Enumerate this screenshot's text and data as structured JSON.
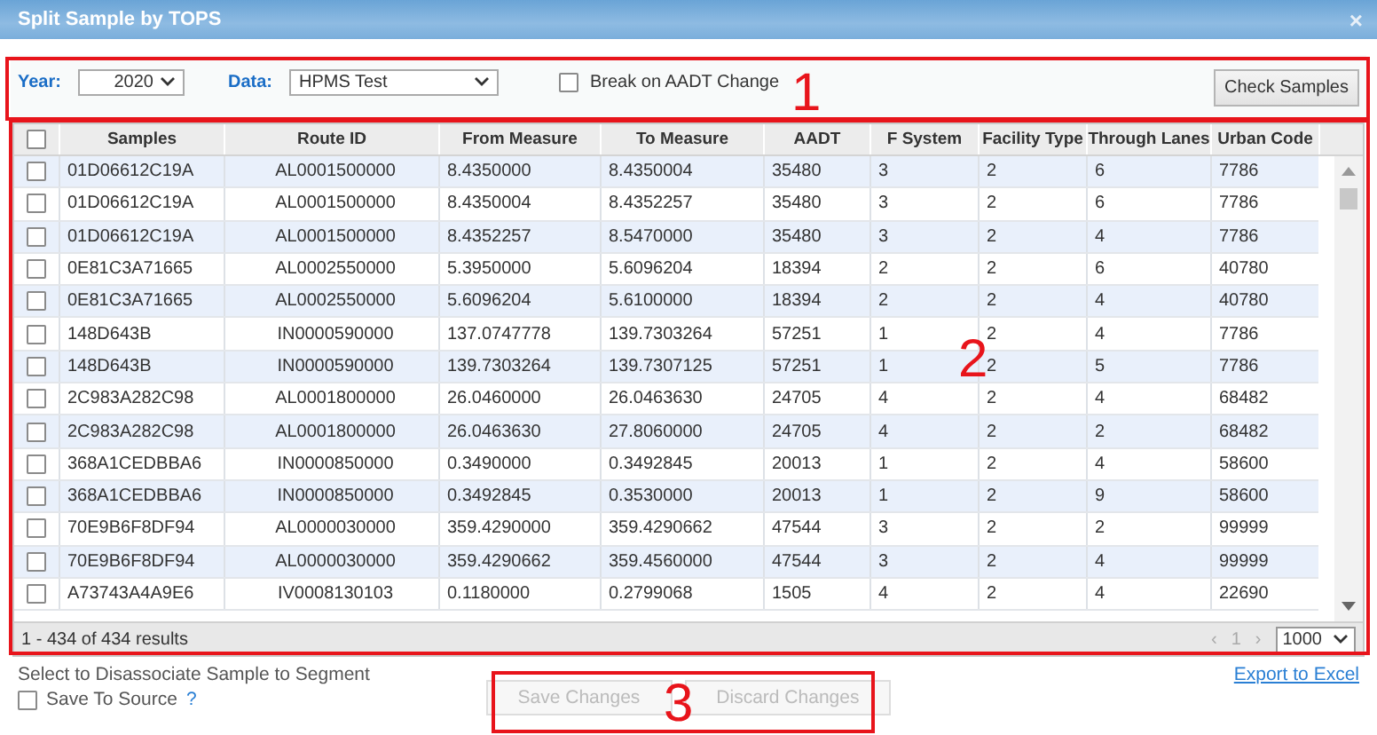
{
  "window": {
    "title": "Split Sample by TOPS",
    "close": "×"
  },
  "toolbar": {
    "year_label": "Year:",
    "year": "2020",
    "data_label": "Data:",
    "data": "HPMS Test",
    "break_on_aadt": {
      "label": "Break on AADT Change",
      "checked": false
    },
    "check_button": "Check Samples"
  },
  "table": {
    "select_all_checked": false,
    "columns": [
      "Samples",
      "Route ID",
      "From Measure",
      "To Measure",
      "AADT",
      "F System",
      "Facility Type",
      "Through Lanes",
      "Urban Code"
    ],
    "rows": [
      {
        "checked": false,
        "cells": [
          "01D06612C19A",
          "AL0001500000",
          "8.4350000",
          "8.4350004",
          "35480",
          "3",
          "2",
          "6",
          "7786"
        ]
      },
      {
        "checked": false,
        "cells": [
          "01D06612C19A",
          "AL0001500000",
          "8.4350004",
          "8.4352257",
          "35480",
          "3",
          "2",
          "6",
          "7786"
        ]
      },
      {
        "checked": false,
        "cells": [
          "01D06612C19A",
          "AL0001500000",
          "8.4352257",
          "8.5470000",
          "35480",
          "3",
          "2",
          "4",
          "7786"
        ]
      },
      {
        "checked": false,
        "cells": [
          "0E81C3A71665",
          "AL0002550000",
          "5.3950000",
          "5.6096204",
          "18394",
          "2",
          "2",
          "6",
          "40780"
        ]
      },
      {
        "checked": false,
        "cells": [
          "0E81C3A71665",
          "AL0002550000",
          "5.6096204",
          "5.6100000",
          "18394",
          "2",
          "2",
          "4",
          "40780"
        ]
      },
      {
        "checked": false,
        "cells": [
          "148D643B",
          "IN0000590000",
          "137.0747778",
          "139.7303264",
          "57251",
          "1",
          "2",
          "4",
          "7786"
        ]
      },
      {
        "checked": false,
        "cells": [
          "148D643B",
          "IN0000590000",
          "139.7303264",
          "139.7307125",
          "57251",
          "1",
          "2",
          "5",
          "7786"
        ]
      },
      {
        "checked": false,
        "cells": [
          "2C983A282C98",
          "AL0001800000",
          "26.0460000",
          "26.0463630",
          "24705",
          "4",
          "2",
          "4",
          "68482"
        ]
      },
      {
        "checked": false,
        "cells": [
          "2C983A282C98",
          "AL0001800000",
          "26.0463630",
          "27.8060000",
          "24705",
          "4",
          "2",
          "2",
          "68482"
        ]
      },
      {
        "checked": false,
        "cells": [
          "368A1CEDBBA6",
          "IN0000850000",
          "0.3490000",
          "0.3492845",
          "20013",
          "1",
          "2",
          "4",
          "58600"
        ]
      },
      {
        "checked": false,
        "cells": [
          "368A1CEDBBA6",
          "IN0000850000",
          "0.3492845",
          "0.3530000",
          "20013",
          "1",
          "2",
          "9",
          "58600"
        ]
      },
      {
        "checked": false,
        "cells": [
          "70E9B6F8DF94",
          "AL0000030000",
          "359.4290000",
          "359.4290662",
          "47544",
          "3",
          "2",
          "2",
          "99999"
        ]
      },
      {
        "checked": false,
        "cells": [
          "70E9B6F8DF94",
          "AL0000030000",
          "359.4290662",
          "359.4560000",
          "47544",
          "3",
          "2",
          "4",
          "99999"
        ]
      },
      {
        "checked": false,
        "cells": [
          "A73743A4A9E6",
          "IV0008130103",
          "0.1180000",
          "0.2799068",
          "1505",
          "4",
          "2",
          "4",
          "22690"
        ]
      }
    ],
    "results": "1 - 434 of 434 results",
    "pager": {
      "prev": "‹",
      "page": "1",
      "next": "›",
      "page_size": "1000"
    }
  },
  "footer": {
    "hint": "Select to Disassociate Sample to Segment",
    "save_to_source": {
      "label": "Save To Source",
      "checked": false
    },
    "help": "?",
    "export": "Export to Excel"
  },
  "buttons": [
    {
      "label": "Save Changes",
      "disabled": true
    },
    {
      "label": "Discard Changes",
      "disabled": true
    }
  ],
  "annotations": [
    {
      "number": "1"
    },
    {
      "number": "2"
    },
    {
      "number": "3"
    }
  ]
}
